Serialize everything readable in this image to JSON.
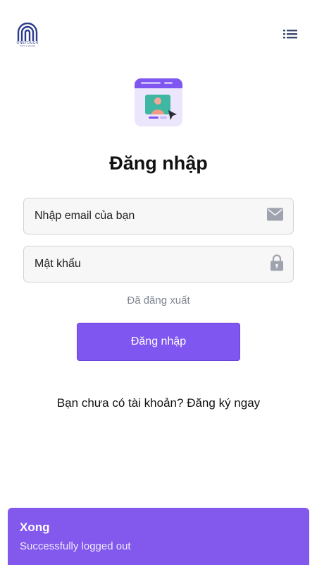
{
  "header": {
    "logo_text": "ONETOUCH",
    "logo_subtext": "TRUST & SECURE",
    "menu_icon": "hamburger-list-icon"
  },
  "login": {
    "title": "Đăng nhập",
    "email_placeholder": "Nhập email của bạn",
    "email_icon": "envelope-icon",
    "password_placeholder": "Mật khẩu",
    "password_icon": "lock-icon",
    "status": "Đã đăng xuất",
    "submit_label": "Đăng nhập",
    "signup_prompt": "Bạn chưa có tài khoản?",
    "signup_link": "Đăng ký ngay"
  },
  "toast": {
    "title": "Xong",
    "message": "Successfully logged out"
  },
  "colors": {
    "accent": "#7f56ef",
    "toast_bg": "#8258ed",
    "muted_text": "#7f8591"
  }
}
